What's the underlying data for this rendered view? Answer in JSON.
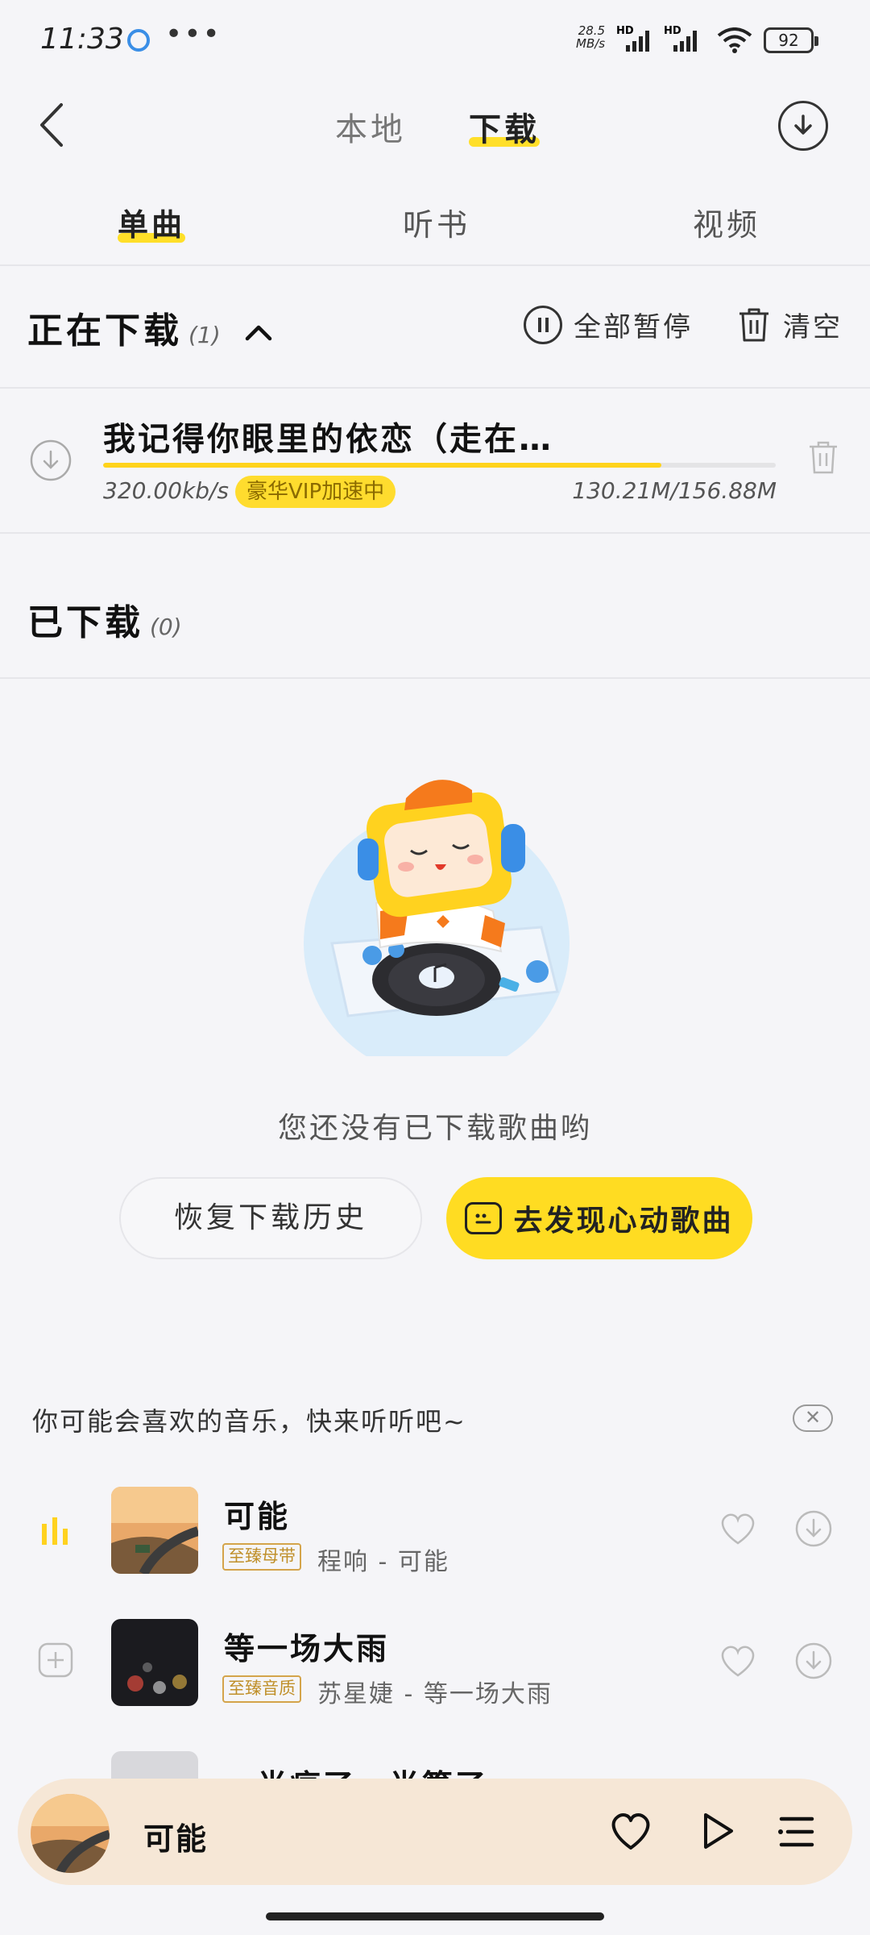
{
  "status_bar": {
    "time": "11:33",
    "net_speed_value": "28.5",
    "net_speed_unit": "MB/s",
    "sim1": "HD",
    "sim2": "HD",
    "battery": "92"
  },
  "header": {
    "tabs": [
      {
        "label": "本地",
        "active": false
      },
      {
        "label": "下载",
        "active": true
      }
    ]
  },
  "sub_tabs": [
    {
      "label": "单曲",
      "active": true
    },
    {
      "label": "听书",
      "active": false
    },
    {
      "label": "视频",
      "active": false
    }
  ],
  "downloading": {
    "title": "正在下载",
    "count": "(1)",
    "pause_all_label": "全部暂停",
    "clear_label": "清空",
    "item": {
      "title": "我记得你眼里的依恋（走在…",
      "speed": "320.00kb/s",
      "badge": "豪华VIP加速中",
      "size": "130.21M/156.88M",
      "progress": 0.83
    }
  },
  "downloaded": {
    "title": "已下载",
    "count": "(0)"
  },
  "empty_state": {
    "message": "您还没有已下载歌曲哟",
    "restore_button": "恢复下载历史",
    "discover_button": "去发现心动歌曲"
  },
  "recommend": {
    "title": "你可能会喜欢的音乐，快来听听吧~",
    "songs": [
      {
        "name": "可能",
        "tag": "至臻母带",
        "artist": "程响 - 可能",
        "playing": true
      },
      {
        "name": "等一场大雨",
        "tag": "至臻音质",
        "artist": "苏星婕 - 等一场大雨",
        "playing": false
      },
      {
        "name": "一半疯了一半算了",
        "tag": "",
        "artist": "",
        "playing": false
      }
    ]
  },
  "player": {
    "title": "可能"
  },
  "colors": {
    "accent_yellow": "#ffdc22",
    "background": "#f5f5f8",
    "player_bg": "#f6e7d6",
    "tag_gold": "#c0902a"
  }
}
